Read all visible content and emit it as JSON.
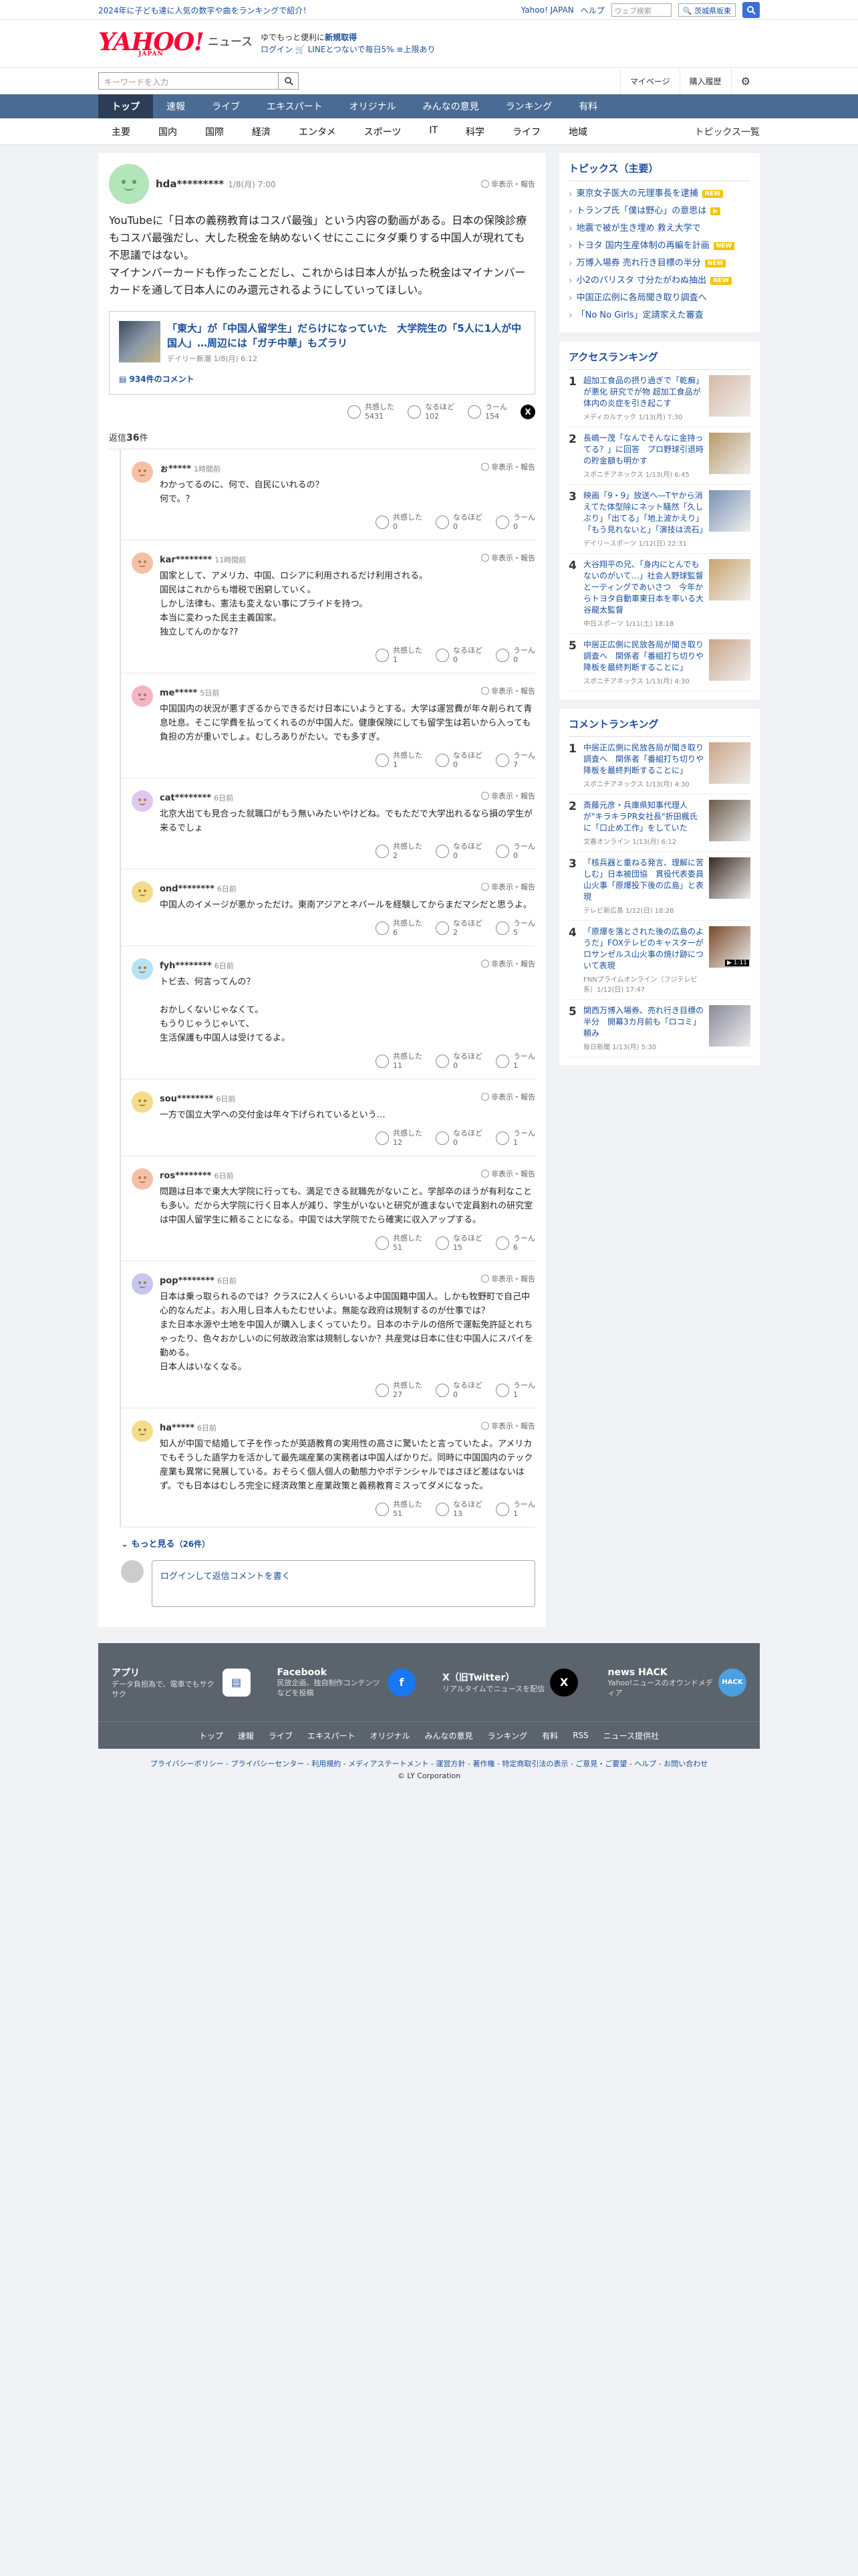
{
  "promo": {
    "text": "2024年に子ども達に人気の数字や曲をランキングで紹介！",
    "links": [
      "Yahoo! JAPAN",
      "ヘルプ"
    ],
    "kw_placeholder": "ウェブ検索",
    "kw_btn": "🔍 茨城県坂東",
    "search_color": "#3a6fd8"
  },
  "header": {
    "logo": "YAHOO!",
    "logo_sub": "JAPAN",
    "logo_suffix": "ニュース",
    "line1": "ゆでもっと便利に",
    "line1_link": "新規取得",
    "line2": "ログイン 🛒 LINEとつないで毎日5% ≡上限あり"
  },
  "search": {
    "placeholder": "キーワードを入力",
    "links": [
      "マイページ",
      "購入履歴"
    ]
  },
  "nav": {
    "items": [
      "トップ",
      "速報",
      "ライブ",
      "エキスパート",
      "オリジナル",
      "みんなの意見",
      "ランキング",
      "有料"
    ],
    "active": 0
  },
  "cats": {
    "items": [
      "主要",
      "国内",
      "国際",
      "経済",
      "エンタメ",
      "スポーツ",
      "IT",
      "科学",
      "ライフ",
      "地域"
    ],
    "more": "トピックス一覧"
  },
  "post": {
    "user": "hda*********",
    "time": "1/8(月) 7:00",
    "report": "非表示・報告",
    "body": "YouTubeに「日本の義務教育はコスパ最強」という内容の動画がある。日本の保険診療もコスパ最強だし、大した税金を納めないくせにここにタダ乗りする中国人が現れても不思議ではない。\nマイナンバーカードも作ったことだし、これからは日本人が払った税金はマイナンバーカードを通して日本人にのみ還元されるようにしていってほしい。",
    "article": {
      "title": "「東大」が「中国人留学生」だらけになっていた　大学院生の「5人に1人が中国人」…周辺には「ガチ中華」もズラリ",
      "source": "デイリー新潮 1/8(月) 6:12",
      "comments": "934件のコメント"
    },
    "reactions": {
      "a_label": "共感した",
      "a": "5431",
      "b_label": "なるほど",
      "b": "102",
      "c_label": "うーん",
      "c": "154"
    }
  },
  "reply_count": {
    "prefix": "返信",
    "num": "36",
    "suffix": "件"
  },
  "replies": [
    {
      "user": "ぉ*****",
      "time": "1時間前",
      "text": "わかってるのに、何で、自民にいれるの？\n何で。？",
      "a": "0",
      "b": "0",
      "c": "0",
      "avatar": "#f6c0a8"
    },
    {
      "user": "kar********",
      "time": "11時間前",
      "text": "国家として、アメリカ、中国、ロシアに利用されるだけ利用される。\n国民はこれからも増税で困窮していく。\nしかし法律も、憲法も変えない事にプライドを持つ。\n本当に変わった民主主義国家。\n独立してんのかな??",
      "a": "1",
      "b": "0",
      "c": "0",
      "avatar": "#f6c0a8"
    },
    {
      "user": "me*****",
      "time": "5日前",
      "text": "中国国内の状況が悪すぎるからできるだけ日本にいようとする。大学は運営費が年々削られて青息吐息。そこに学費を払ってくれるのが中国人だ。健康保険にしても留学生は若いから入っても負担の方が重いでしょ。むしろありがたい。でも多すぎ。",
      "a": "1",
      "b": "0",
      "c": "7",
      "avatar": "#f6b3c6"
    },
    {
      "user": "cat********",
      "time": "6日前",
      "text": "北京大出ても見合った就職口がもう無いみたいやけどね。でもただで大学出れるなら損の学生が来るでしょ",
      "a": "2",
      "b": "0",
      "c": "0",
      "avatar": "#e0c6f0"
    },
    {
      "user": "ond********",
      "time": "6日前",
      "text": "中国人のイメージが悪かっただけ。東南アジアとネパールを経験してからまだマシだと思うよ。",
      "a": "6",
      "b": "2",
      "c": "5",
      "avatar": "#f4dc8a"
    },
    {
      "user": "fyh********",
      "time": "6日前",
      "text": "トビ去、何言ってんの？\n\nおかしくないじゃなくて。\nもうりじゃうじゃいて、\n生活保護も中国人は受けてるよ。",
      "a": "11",
      "b": "0",
      "c": "1",
      "avatar": "#b6e2f4"
    },
    {
      "user": "sou********",
      "time": "6日前",
      "text": "一方で国立大学への交付金は年々下げられているという…",
      "a": "12",
      "b": "0",
      "c": "1",
      "avatar": "#f4dc8a"
    },
    {
      "user": "ros********",
      "time": "6日前",
      "text": "問題は日本で東大大学院に行っても、満足できる就職先がないこと。学部卒のほうが有利なことも多い。だから大学院に行く日本人が減り、学生がいないと研究が進まないで定員割れの研究室は中国人留学生に頼ることになる。中国では大学院でたら確実に収入アップする。",
      "a": "51",
      "b": "15",
      "c": "6",
      "avatar": "#f6c0a8"
    },
    {
      "user": "pop********",
      "time": "6日前",
      "text": "日本は乗っ取られるのでは？クラスに2人くらいいるよ中国国籍中国人。しかも牧野町で自己中心的なんだよ。お入用し日本人もたむせいよ。無能な政府は規制するのが仕事では？\nまた日本水源や土地を中国人が購入しまくっていたり。日本のホテルの倍所で運転免許証とれちゃったり、色々おかしいのに何故政治家は規制しないか？共産党は日本に住む中国人にスパイを勤める。\n日本人はいなくなる。",
      "a": "27",
      "b": "0",
      "c": "1",
      "avatar": "#c6c6f0"
    },
    {
      "user": "ha*****",
      "time": "6日前",
      "text": "知人が中国で結婚して子を作ったが英語教育の実用性の高さに驚いたと言っていたよ。アメリカでもそうした語学力を活かして最先端産業の実務者は中国人ばかりだ。同時に中国国内のテック産業も異常に発展している。おそらく個人個人の動態力やポテンシャルではさほど差はないはず。でも日本はむしろ完全に経済政策と産業政策と義務教育ミスってダメになった。",
      "a": "51",
      "b": "13",
      "c": "1",
      "avatar": "#f4dc8a"
    }
  ],
  "more_label": "もっと見る",
  "more_count": "（26件）",
  "write_placeholder": "ログインして返信コメントを書く",
  "topics": {
    "title": "トピックス（主要）",
    "items": [
      {
        "t": "東京女子医大の元理事長を逮捕",
        "badge": "NEW"
      },
      {
        "t": "トランプ氏「僕は野心」の意思は",
        "badge": "▶"
      },
      {
        "t": "地震で被が生き埋め 救え大学で",
        "badge": ""
      },
      {
        "t": "トヨタ 国内生産体制の再編を計画",
        "badge": "NEW"
      },
      {
        "t": "万博入場券 売れ行き目標の半分",
        "badge": "NEW"
      },
      {
        "t": "小2のパリスタ 寸分たがわぬ抽出",
        "badge": "NEW"
      },
      {
        "t": "中国正広例に各局聞き取り調査へ",
        "badge": ""
      },
      {
        "t": "「No No Girls」定請家えた審査",
        "badge": ""
      }
    ]
  },
  "access": {
    "title": "アクセスランキング",
    "items": [
      {
        "n": "1",
        "t": "超加工食品の摂り過ぎで「乾癬」が悪化 研究でが物 超加工食品が体内の炎症を引き起こす",
        "s": "メディカルナック 1/13(月) 7:30",
        "c": "#d9b9a6"
      },
      {
        "n": "2",
        "t": "長嶋一茂「なんでそんなに金持ってる？」に回答　プロ野球引退時の貯金額も明かす",
        "s": "スポニチアネックス 1/13(月) 6:45",
        "c": "#b99a6a"
      },
      {
        "n": "3",
        "t": "映画「9・9」放送へ―Tヤから消えてた体型除にネット騒然「久しぶり」「出てる」「地上波かえり」「もう見れないと」「演技は流石」",
        "s": "デイリースポーツ 1/12(日) 22:31",
        "c": "#7a93b5"
      },
      {
        "n": "4",
        "t": "大谷翔平の兄、「身内にとんでもないのがいて…」社会人野球監督とーティングであいさつ　今年からトヨタ自動車東日本を率いる大谷龍太監督",
        "s": "中日スポーツ 1/11(土) 18:18",
        "c": "#c8a46a"
      },
      {
        "n": "5",
        "t": "中居正広側に民放各局が聞き取り調査へ　関係者「番組打ち切りや降板を最終判断することに」",
        "s": "スポニチアネックス 1/13(月) 4:30",
        "c": "#caa58a"
      }
    ]
  },
  "comment_rank": {
    "title": "コメントランキング",
    "items": [
      {
        "n": "1",
        "t": "中居正広側に民放各局が聞き取り調査へ　関係者「番組打ち切りや降板を最終判断することに」",
        "s": "スポニチアネックス 1/13(月) 4:30",
        "c": "#caa58a"
      },
      {
        "n": "2",
        "t": "斎藤元彦・兵庫県知事代理人が\"キラキラPR女社長\"折田楓氏に「口止め工作」をしていた",
        "s": "文春オンライン 1/13(月) 6:12",
        "c": "#6a5a4a"
      },
      {
        "n": "3",
        "t": "「核兵器と重ねる発言、理解に苦しむ」日本被団協　貫役代表委員山火事「原爆投下後の広島」と表現",
        "s": "テレビ新広島 1/12(日) 18:28",
        "c": "#3a2a20"
      },
      {
        "n": "4",
        "t": "「原爆を落とされた後の広島のようだ」FOXテレビのキャスターがロサンゼルス山火事の焼け跡について表現",
        "s": "FNNプライムオンライン（フジテレビ系）1/12(日) 17:47",
        "c": "#7a4a2a",
        "tag": "▶ 1:11"
      },
      {
        "n": "5",
        "t": "関西万博入場券、売れ行き目標の半分　開幕3カ月前も「ロコミ」頼み",
        "s": "毎日新聞 1/13(月) 5:30",
        "c": "#8a8a9a"
      }
    ]
  },
  "footer": {
    "apps": [
      {
        "t": "アプリ",
        "d": "データ負担為で、電車でもサクサク",
        "ic": "#ffffff",
        "glyph": "▤"
      },
      {
        "t": "Facebook",
        "d": "民放企画、独自制作コンテンツなどを投稿",
        "ic": "#1877f2",
        "glyph": "f"
      },
      {
        "t": "X（旧Twitter）",
        "d": "リアルタイムでニュースを配信",
        "ic": "#000000",
        "glyph": "X"
      },
      {
        "t": "news HACK",
        "d": "Yahoo!ニュースのオウンドメディア",
        "ic": "#4aa0e0",
        "glyph": "HACK"
      }
    ],
    "links": [
      "トップ",
      "速報",
      "ライブ",
      "エキスパート",
      "オリジナル",
      "みんなの意見",
      "ランキング",
      "有料",
      "RSS",
      "ニュース提供社"
    ],
    "bottom_links": "プライバシーポリシー - プライバシーセンター - 利用規約 - メディアステートメント - 運営方針 - 著作権 - 特定商取引法の表示 - ご意見・ご要望 - ヘルプ - お問い合わせ",
    "copyright": "© LY Corporation"
  }
}
